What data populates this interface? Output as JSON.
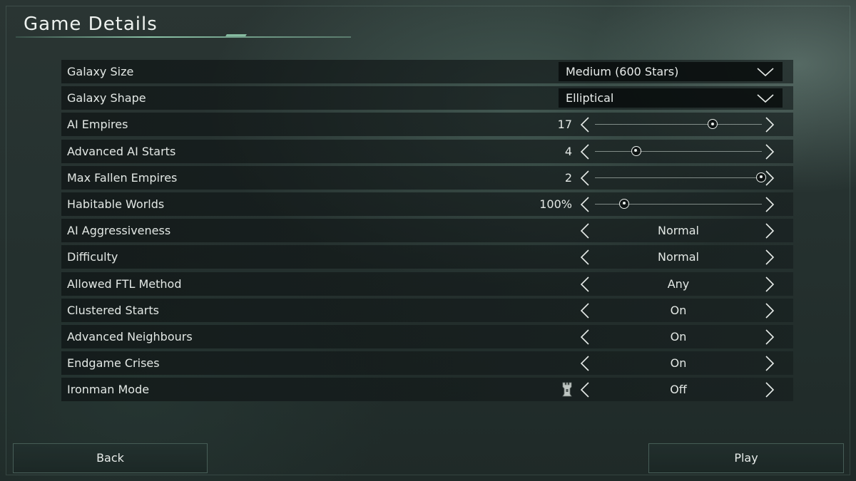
{
  "header": {
    "title": "Game Details"
  },
  "settings": [
    {
      "label": "Galaxy Size",
      "control": "dropdown",
      "value": "Medium (600 Stars)",
      "icon": "chevron-down-icon"
    },
    {
      "label": "Galaxy Shape",
      "control": "dropdown",
      "value": "Elliptical",
      "icon": "chevron-down-icon"
    },
    {
      "label": "AI Empires",
      "control": "slider",
      "value": "17",
      "slider_fraction": 0.71
    },
    {
      "label": "Advanced AI Starts",
      "control": "slider",
      "value": "4",
      "slider_fraction": 0.25
    },
    {
      "label": "Max Fallen Empires",
      "control": "slider",
      "value": "2",
      "slider_fraction": 1.0
    },
    {
      "label": "Habitable Worlds",
      "control": "slider",
      "value": "100%",
      "slider_fraction": 0.18
    },
    {
      "label": "AI Aggressiveness",
      "control": "cycle",
      "value": "Normal"
    },
    {
      "label": "Difficulty",
      "control": "cycle",
      "value": "Normal"
    },
    {
      "label": "Allowed FTL Method",
      "control": "cycle",
      "value": "Any"
    },
    {
      "label": "Clustered Starts",
      "control": "cycle",
      "value": "On"
    },
    {
      "label": "Advanced Neighbours",
      "control": "cycle",
      "value": "On"
    },
    {
      "label": "Endgame Crises",
      "control": "cycle",
      "value": "On"
    },
    {
      "label": "Ironman Mode",
      "control": "cycle",
      "value": "Off",
      "icon": "ironman-tower-icon"
    }
  ],
  "footer": {
    "back_label": "Back",
    "play_label": "Play"
  },
  "colors": {
    "accent": "#96d2b4",
    "row_bg": "#141b1b",
    "text": "#e3e8e5"
  }
}
